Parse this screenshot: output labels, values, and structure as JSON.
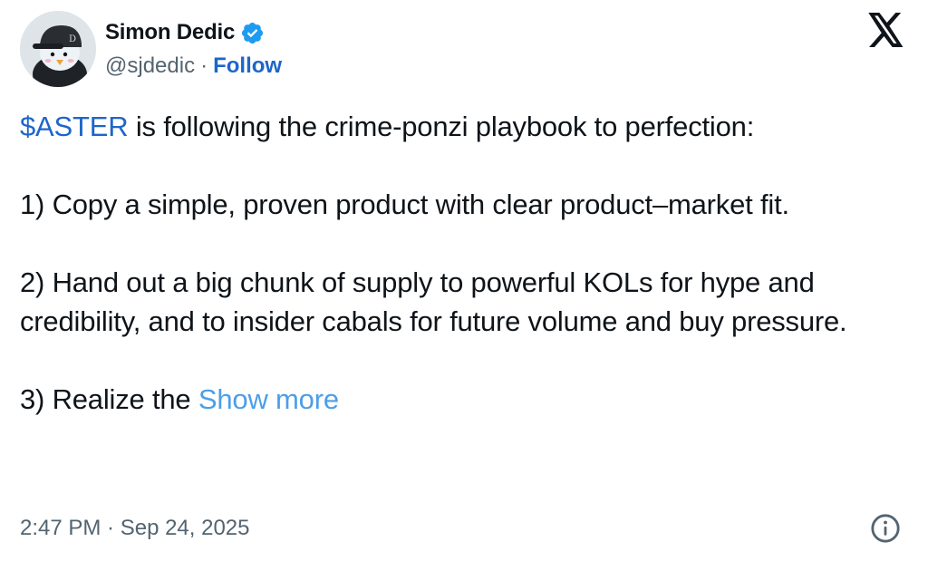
{
  "author": {
    "name": "Simon Dedic",
    "handle": "@sjdedic",
    "separator": "·",
    "follow_label": "Follow",
    "verified": true,
    "avatar": "penguin-avatar"
  },
  "brand": {
    "logo": "x-logo"
  },
  "tweet": {
    "cashtag": "$ASTER",
    "line1_rest": " is following the crime-ponzi playbook to perfection:",
    "point1": "1) Copy a simple, proven product with clear product–market fit.",
    "point2": "2) Hand out a big chunk of supply to powerful KOLs for hype and credibility, and to insider cabals for future volume and buy pressure.",
    "point3_start": "3) Realize the ",
    "show_more": "Show more"
  },
  "meta": {
    "timestamp": "2:47 PM · Sep 24, 2025",
    "info_icon": "info-icon"
  },
  "colors": {
    "link": "#1d66c9",
    "show_more": "#4c9ee8",
    "secondary": "#536471",
    "text": "#0f1419",
    "verified": "#1d9bf0"
  }
}
